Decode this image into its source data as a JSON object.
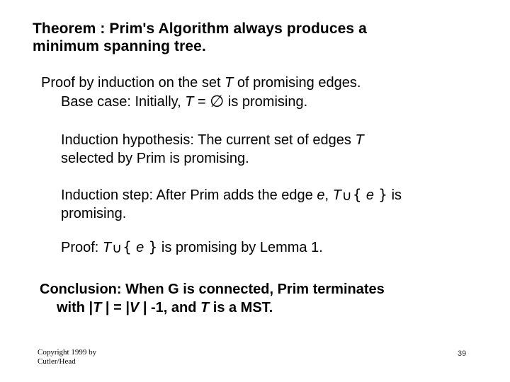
{
  "slide": {
    "background_color": "#ffffff",
    "text_color": "#000000",
    "theorem": {
      "line1": "Theorem : Prim's Algorithm always produces a",
      "line2": "minimum spanning tree."
    },
    "proof_intro": {
      "line1_a": "Proof by induction on the set ",
      "line1_var": "T",
      "line1_b": " of promising edges.",
      "line2_a": "Base case: Initially, ",
      "line2_var": "T",
      "line2_eq": " = ",
      "line2_symbol": "∅",
      "line2_b": " is promising."
    },
    "induction_hypothesis": {
      "line1_a": "Induction hypothesis:  The current set of edges ",
      "line1_var": "T",
      "line2": "selected by Prim is promising."
    },
    "induction_step": {
      "line1_a": "Induction step: After Prim adds the edge ",
      "line1_var_e": "e",
      "line1_b": ", ",
      "line1_var_t": "T",
      "line1_union": "∪",
      "line1_brace_open": "{ ",
      "line1_var_e2": "e",
      "line1_brace_close": " }",
      "line1_c": " is",
      "line2": "promising."
    },
    "lemma_proof": {
      "prefix": "Proof: ",
      "var_t": "T",
      "union": "∪",
      "brace_open": "{ ",
      "var_e": "e",
      "brace_close": " }",
      "suffix": " is promising by Lemma 1."
    },
    "conclusion": {
      "line1": "Conclusion: When G is connected, Prim terminates",
      "line2_a": "with |",
      "line2_var_t": "T",
      "line2_b": " | = |",
      "line2_var_v": "V",
      "line2_c": " | -1,  and ",
      "line2_var_t2": "T",
      "line2_d": " is a MST."
    },
    "footer": {
      "copyright_line1": "Copyright 1999 by",
      "copyright_line2": "Cutler/Head",
      "page_number": "39"
    }
  }
}
